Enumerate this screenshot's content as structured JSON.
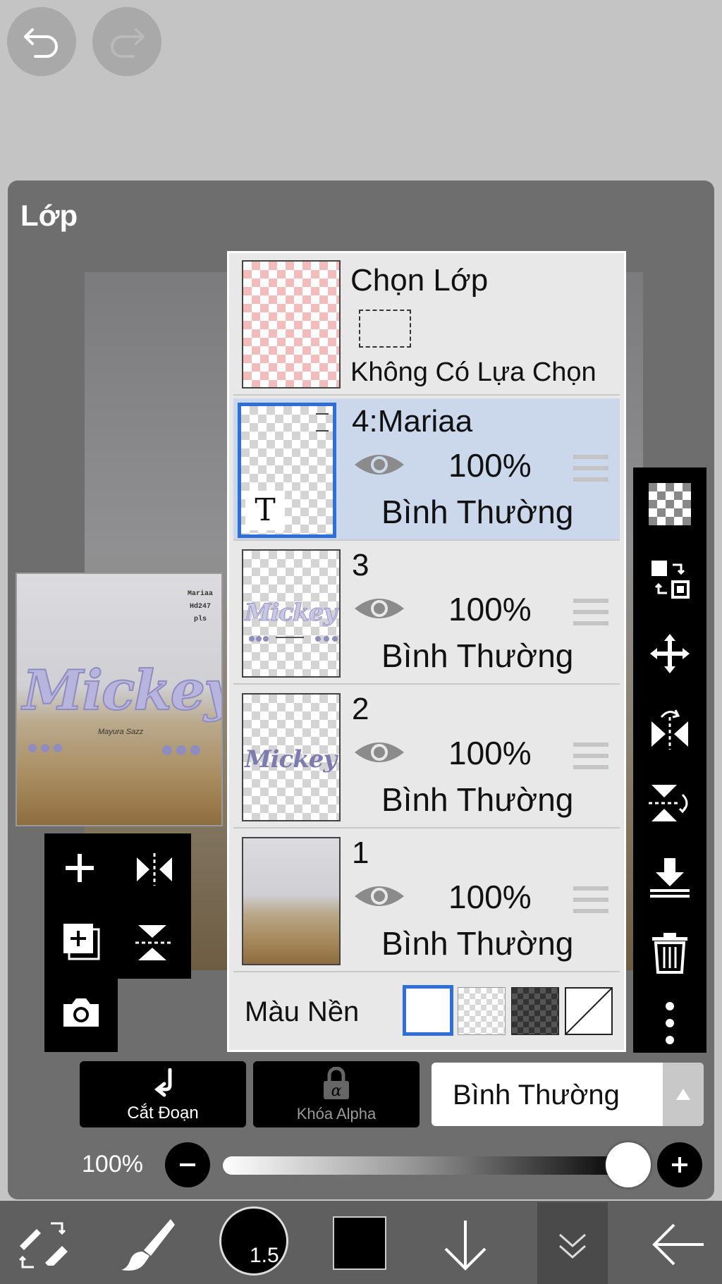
{
  "panel": {
    "title": "Lớp"
  },
  "selection": {
    "title": "Chọn Lớp",
    "status": "Không Có Lựa Chọn"
  },
  "layers": [
    {
      "name": "4:Mariaa",
      "opacity": "100%",
      "blend": "Bình Thường",
      "selected": true,
      "type_badge": "T"
    },
    {
      "name": "3",
      "opacity": "100%",
      "blend": "Bình Thường",
      "selected": false
    },
    {
      "name": "2",
      "opacity": "100%",
      "blend": "Bình Thường",
      "selected": false
    },
    {
      "name": "1",
      "opacity": "100%",
      "blend": "Bình Thường",
      "selected": false
    }
  ],
  "background": {
    "label": "Màu Nền"
  },
  "preview": {
    "title_art": "Mickey",
    "credit_lines": [
      "Mariaa",
      "Hd247",
      "pls"
    ],
    "subtitle": "Mayura Sazz"
  },
  "thumbs": {
    "layer3_art": "Mickey",
    "layer2_art": "Mickey"
  },
  "actions": {
    "clip": "Cắt Đoạn",
    "alpha_lock": "Khóa Alpha",
    "blend_mode": "Bình Thường"
  },
  "opacity_slider": {
    "label": "100%",
    "value": 1.0
  },
  "bottom_bar": {
    "brush_size": "1.5"
  },
  "colors": {
    "accent": "#2f6fd6",
    "selected_row": "#cbd8eb",
    "thumb_pink": "#f3c2c2",
    "art_lilac": "#a9a6cf"
  }
}
